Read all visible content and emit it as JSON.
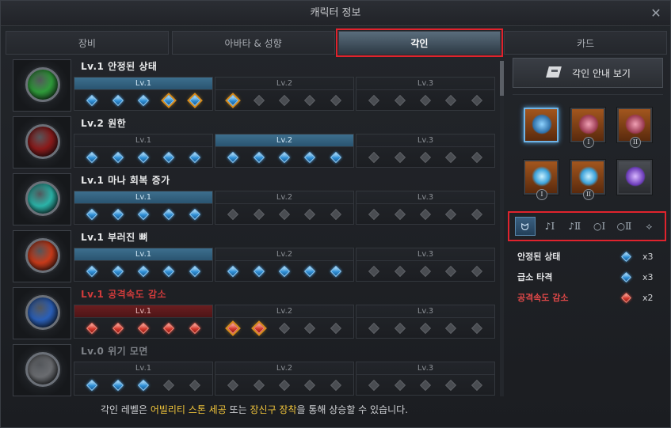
{
  "window": {
    "title": "캐릭터 정보",
    "close_icon": "close-icon"
  },
  "tabs": [
    {
      "label": "장비",
      "active": false
    },
    {
      "label": "아바타 & 성향",
      "active": false
    },
    {
      "label": "각인",
      "active": true
    },
    {
      "label": "카드",
      "active": false
    }
  ],
  "engravings": [
    {
      "title": "Lv.1 안정된 상태",
      "color": "#2f9a3a",
      "style": "normal",
      "levels": [
        {
          "label": "Lv.1",
          "on": "blue"
        },
        {
          "label": "Lv.2",
          "on": ""
        },
        {
          "label": "Lv.3",
          "on": ""
        }
      ],
      "gems": [
        [
          "blue",
          "blue",
          "blue",
          "blue-gold",
          "blue-gold"
        ],
        [
          "blue-gold",
          "off",
          "off",
          "off",
          "off"
        ],
        [
          "off",
          "off",
          "off",
          "off",
          "off"
        ]
      ]
    },
    {
      "title": "Lv.2 원한",
      "color": "#8a1a1a",
      "style": "normal",
      "levels": [
        {
          "label": "Lv.1",
          "on": ""
        },
        {
          "label": "Lv.2",
          "on": "blue"
        },
        {
          "label": "Lv.3",
          "on": ""
        }
      ],
      "gems": [
        [
          "blue",
          "blue",
          "blue",
          "blue",
          "blue"
        ],
        [
          "blue",
          "blue",
          "blue",
          "blue",
          "blue"
        ],
        [
          "off",
          "off",
          "off",
          "off",
          "off"
        ]
      ]
    },
    {
      "title": "Lv.1 마나 회복 증가",
      "color": "#2bb3a8",
      "style": "normal",
      "levels": [
        {
          "label": "Lv.1",
          "on": "blue"
        },
        {
          "label": "Lv.2",
          "on": ""
        },
        {
          "label": "Lv.3",
          "on": ""
        }
      ],
      "gems": [
        [
          "blue",
          "blue",
          "blue",
          "blue",
          "blue"
        ],
        [
          "off",
          "off",
          "off",
          "off",
          "off"
        ],
        [
          "off",
          "off",
          "off",
          "off",
          "off"
        ]
      ]
    },
    {
      "title": "Lv.1 부러진 뼈",
      "color": "#c63a1a",
      "style": "normal",
      "levels": [
        {
          "label": "Lv.1",
          "on": "blue"
        },
        {
          "label": "Lv.2",
          "on": ""
        },
        {
          "label": "Lv.3",
          "on": ""
        }
      ],
      "gems": [
        [
          "blue",
          "blue",
          "blue",
          "blue",
          "blue"
        ],
        [
          "blue",
          "blue",
          "blue",
          "blue",
          "blue"
        ],
        [
          "off",
          "off",
          "off",
          "off",
          "off"
        ]
      ]
    },
    {
      "title": "Lv.1 공격속도 감소",
      "color": "#2a5fb8",
      "style": "red",
      "levels": [
        {
          "label": "Lv.1",
          "on": "red"
        },
        {
          "label": "Lv.2",
          "on": ""
        },
        {
          "label": "Lv.3",
          "on": ""
        }
      ],
      "gems": [
        [
          "red",
          "red",
          "red",
          "red",
          "red"
        ],
        [
          "red-gold",
          "red-gold",
          "off",
          "off",
          "off"
        ],
        [
          "off",
          "off",
          "off",
          "off",
          "off"
        ]
      ]
    },
    {
      "title": "Lv.0 위기 모면",
      "color": "#6a6c70",
      "style": "dim",
      "levels": [
        {
          "label": "Lv.1",
          "on": ""
        },
        {
          "label": "Lv.2",
          "on": ""
        },
        {
          "label": "Lv.3",
          "on": ""
        }
      ],
      "gems": [
        [
          "blue",
          "blue",
          "blue",
          "off",
          "off"
        ],
        [
          "off",
          "off",
          "off",
          "off",
          "off"
        ],
        [
          "off",
          "off",
          "off",
          "off",
          "off"
        ]
      ]
    }
  ],
  "footer": {
    "prefix": "각인 레벨은 ",
    "hl1": "어빌리티 스톤 세공",
    "mid": " 또는 ",
    "hl2": "장신구 장착",
    "suffix": "을 통해 상승할 수 있습니다."
  },
  "side": {
    "guide_label": "각인 안내 보기",
    "slots": [
      {
        "name": "necklace-slot",
        "icon": "necklace-icon",
        "num": "",
        "selected": true
      },
      {
        "name": "earring-slot-1",
        "icon": "earring-icon",
        "num": "I",
        "selected": false
      },
      {
        "name": "earring-slot-2",
        "icon": "earring-icon",
        "num": "II",
        "selected": false
      },
      {
        "name": "ring-slot-1",
        "icon": "ring-icon",
        "num": "I",
        "selected": false
      },
      {
        "name": "ring-slot-2",
        "icon": "ring-icon",
        "num": "II",
        "selected": false
      },
      {
        "name": "ability-stone-slot",
        "icon": "ability-stone-icon",
        "num": "",
        "selected": false
      }
    ],
    "filters": [
      {
        "name": "filter-necklace",
        "glyph": "ᗢ",
        "active": true
      },
      {
        "name": "filter-earring-1",
        "glyph": "♪Ⅰ",
        "active": false
      },
      {
        "name": "filter-earring-2",
        "glyph": "♪Ⅱ",
        "active": false
      },
      {
        "name": "filter-ring-1",
        "glyph": "○Ⅰ",
        "active": false
      },
      {
        "name": "filter-ring-2",
        "glyph": "○Ⅱ",
        "active": false
      },
      {
        "name": "filter-stone",
        "glyph": "⟡",
        "active": false
      }
    ],
    "effects": [
      {
        "name": "안정된 상태",
        "gem": "blue",
        "count": "x3"
      },
      {
        "name": "급소 타격",
        "gem": "blue",
        "count": "x3"
      },
      {
        "name": "공격속도 감소",
        "gem": "red",
        "count": "x2"
      }
    ]
  }
}
